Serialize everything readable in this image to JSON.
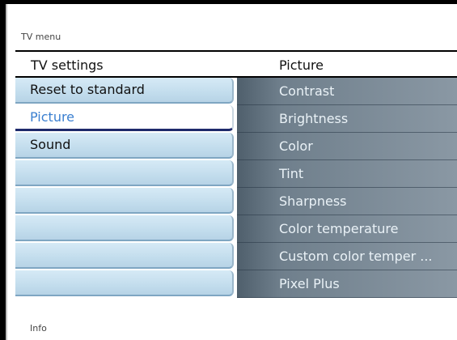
{
  "menu": {
    "title": "TV menu"
  },
  "header": {
    "left": "TV settings",
    "right": "Picture"
  },
  "left_items": [
    {
      "label": "Reset to standard",
      "selected": false
    },
    {
      "label": "Picture",
      "selected": true
    },
    {
      "label": "Sound",
      "selected": false
    },
    {
      "label": "",
      "selected": false
    },
    {
      "label": "",
      "selected": false
    },
    {
      "label": "",
      "selected": false
    },
    {
      "label": "",
      "selected": false
    },
    {
      "label": "",
      "selected": false
    }
  ],
  "right_items": [
    {
      "label": "Contrast"
    },
    {
      "label": "Brightness"
    },
    {
      "label": "Color"
    },
    {
      "label": "Tint"
    },
    {
      "label": "Sharpness"
    },
    {
      "label": "Color temperature"
    },
    {
      "label": "Custom color temper ..."
    },
    {
      "label": "Pixel Plus"
    }
  ],
  "footer": {
    "info_label": "Info"
  },
  "colors": {
    "selected_text": "#3a7fd0",
    "selected_underline": "#1e2a6b",
    "right_panel": "#6f7f8c"
  }
}
